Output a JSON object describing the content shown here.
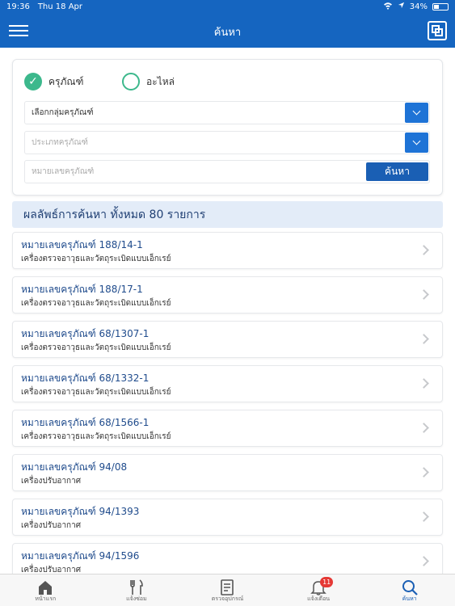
{
  "status_bar": {
    "time": "19:36",
    "date": "Thu 18 Apr",
    "battery": "34%"
  },
  "header": {
    "title": "ค้นหา"
  },
  "search": {
    "radio_equipment": "ครุภัณฑ์",
    "radio_parts": "อะไหล่",
    "group_select": "เลือกกลุ่มครุภัณฑ์",
    "type_placeholder": "ประเภทครุภัณฑ์",
    "number_placeholder": "หมายเลขครุภัณฑ์",
    "search_button": "ค้นหา"
  },
  "results": {
    "header": "ผลลัพธ์การค้นหา ทั้งหมด 80 รายการ",
    "items": [
      {
        "code": "หมายเลขครุภัณฑ์ 188/14-1",
        "desc": "เครื่องตรวจอาวุธและวัตถุระเบิดแบบเอ็กเรย์"
      },
      {
        "code": "หมายเลขครุภัณฑ์ 188/17-1",
        "desc": "เครื่องตรวจอาวุธและวัตถุระเบิดแบบเอ็กเรย์"
      },
      {
        "code": "หมายเลขครุภัณฑ์ 68/1307-1",
        "desc": "เครื่องตรวจอาวุธและวัตถุระเบิดแบบเอ็กเรย์"
      },
      {
        "code": "หมายเลขครุภัณฑ์ 68/1332-1",
        "desc": "เครื่องตรวจอาวุธและวัตถุระเบิดแบบเอ็กเรย์"
      },
      {
        "code": "หมายเลขครุภัณฑ์ 68/1566-1",
        "desc": "เครื่องตรวจอาวุธและวัตถุระเบิดแบบเอ็กเรย์"
      },
      {
        "code": "หมายเลขครุภัณฑ์ 94/08",
        "desc": "เครื่องปรับอากาศ"
      },
      {
        "code": "หมายเลขครุภัณฑ์ 94/1393",
        "desc": "เครื่องปรับอากาศ"
      },
      {
        "code": "หมายเลขครุภัณฑ์ 94/1596",
        "desc": "เครื่องปรับอากาศ"
      }
    ]
  },
  "tabs": {
    "home": "หน้าแรก",
    "repair": "แจ้งซ่อม",
    "inspect": "ตรวจอุปกรณ์",
    "notify": "แจ้งเตือน",
    "notify_badge": "11",
    "search": "ค้นหา"
  },
  "colors": {
    "primary": "#1565c0",
    "accent_green": "#3cb88c",
    "badge_red": "#e53935"
  }
}
